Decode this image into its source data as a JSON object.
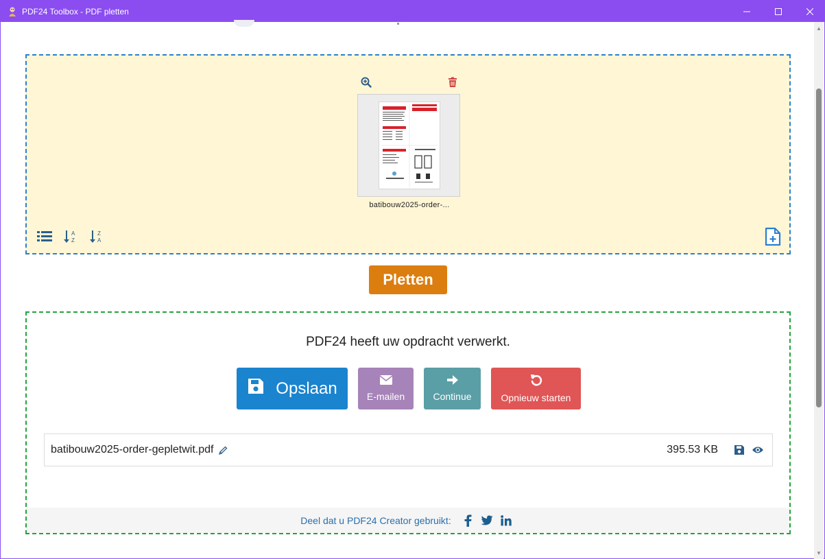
{
  "window": {
    "title": "PDF24 Toolbox - PDF pletten"
  },
  "dropzone": {
    "file": {
      "name": "batibouw2025-order-..."
    }
  },
  "actions": {
    "pletten_label": "Pletten"
  },
  "result": {
    "message": "PDF24 heeft uw opdracht verwerkt.",
    "buttons": {
      "save": "Opslaan",
      "email": "E-mailen",
      "continue": "Continue",
      "restart": "Opnieuw starten"
    },
    "file": {
      "name": "batibouw2025-order-gepletwit.pdf",
      "size": "395.53 KB"
    },
    "share": {
      "text": "Deel dat u PDF24 Creator gebruikt:"
    }
  },
  "icons": {
    "zoom": "zoom-in-icon",
    "trash": "trash-icon",
    "list": "list-icon",
    "sort_az": "sort-alpha-asc-icon",
    "sort_za": "sort-alpha-desc-icon",
    "add_file": "add-file-icon",
    "save": "save-icon",
    "email": "envelope-icon",
    "continue": "arrow-right-icon",
    "restart": "undo-icon",
    "pencil": "pencil-icon",
    "eye": "eye-icon",
    "facebook": "facebook-icon",
    "twitter": "twitter-icon",
    "linkedin": "linkedin-icon"
  },
  "colors": {
    "titlebar": "#8b4df0",
    "dropzone_bg": "#fff6d6",
    "dropzone_border": "#2a7fd0",
    "pletten": "#dc7d10",
    "save": "#1a84cf",
    "email": "#a683b8",
    "continue": "#5a9ea6",
    "restart": "#e05555",
    "result_border": "#21a43a"
  }
}
